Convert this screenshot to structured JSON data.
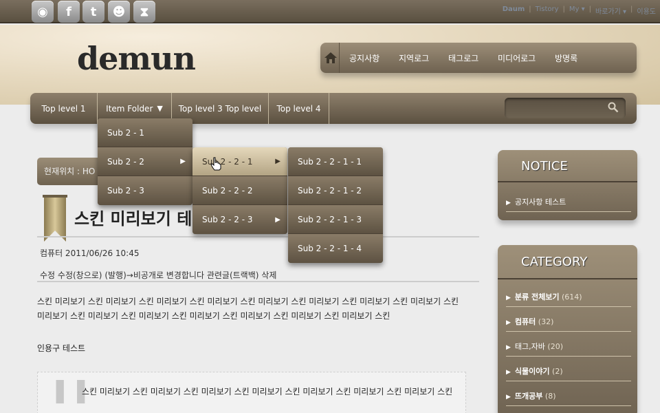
{
  "topbar": {
    "social_icons": [
      {
        "name": "rss-icon",
        "glyph": "◉"
      },
      {
        "name": "facebook-icon",
        "glyph": "f"
      },
      {
        "name": "twitter-icon",
        "glyph": "t"
      },
      {
        "name": "me2day-icon",
        "glyph": "☻"
      },
      {
        "name": "hourglass-icon",
        "glyph": "⧗"
      }
    ],
    "links": [
      "Daum",
      "Tistory",
      "My ▾",
      "바로가기 ▾",
      "이용도"
    ]
  },
  "header": {
    "logo": "demun",
    "gnb": [
      "공지사항",
      "지역로그",
      "태그로그",
      "미디어로그",
      "방명록"
    ]
  },
  "nav": {
    "items": [
      "Top level 1",
      "Item Folder",
      "Top level 3 Top level",
      "Top level 4"
    ],
    "dropdown_level1": [
      "Sub 2 - 1",
      "Sub 2 - 2",
      "Sub 2 - 3"
    ],
    "dropdown_level2": [
      "Sub 2 - 2 - 1",
      "Sub 2 - 2 - 2",
      "Sub 2 - 2 - 3"
    ],
    "dropdown_level3": [
      "Sub 2 - 2 - 1 - 1",
      "Sub 2 - 2 - 1 - 2",
      "Sub 2 - 2 - 1 - 3",
      "Sub 2 - 2 - 1 - 4"
    ]
  },
  "post": {
    "location": "현재위치 : HO",
    "title": "스킨 미리보기 테",
    "meta": "컴퓨터 2011/06/26 10:45",
    "actions": [
      "수정",
      "수정(창으로)",
      "(발행)",
      "→비공개로 변경합니다",
      "관련글(트랙백)",
      "삭제"
    ],
    "body": "스킨 미리보기 스킨 미리보기 스킨 미리보기 스킨 미리보기 스킨 미리보기 스킨 미리보기 스킨 미리보기 스킨 미리보기 스킨 미리보기 스킨 미리보기 스킨 미리보기 스킨 미리보기 스킨 미리보기 스킨 미리보기 스킨 미리보기 스킨",
    "quote_title": "인용구 테스트",
    "quote_text": "스킨 미리보기 스킨 미리보기 스킨 미리보기 스킨 미리보기 스킨 미리보기 스킨 미리보기 스킨 미리보기 스킨"
  },
  "sidebar": {
    "notice": {
      "title": "NOTICE",
      "items": [
        "공지사항 테스트"
      ]
    },
    "category": {
      "title": "CATEGORY",
      "items": [
        {
          "label": "분류 전체보기",
          "count": "(614)"
        },
        {
          "label": "컴퓨터",
          "count": "(32)"
        },
        {
          "label": "태그,자바",
          "count": "(20)"
        },
        {
          "label": "식물이야기",
          "count": "(2)"
        },
        {
          "label": "뜨개공부",
          "count": "(8)"
        }
      ]
    }
  },
  "colors": {
    "brand": "#6e6250",
    "header_bg": "#e6d9bf",
    "active_item": "#e5d8bb"
  }
}
